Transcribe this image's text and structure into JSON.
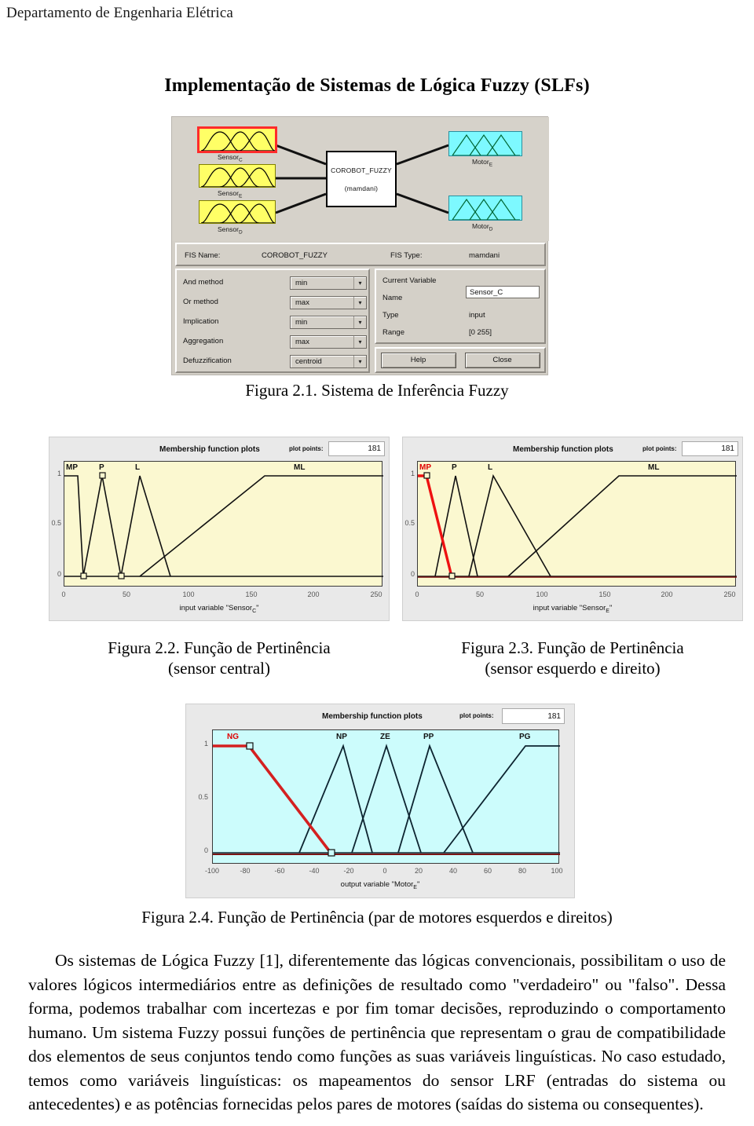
{
  "header": {
    "department": "Departamento de Engenharia Elétrica"
  },
  "page_title": "Implementação de Sistemas de Lógica Fuzzy (SLFs)",
  "fis_editor": {
    "center_name": "COROBOT_FUZZY",
    "center_type": "(mamdani)",
    "inputs": [
      {
        "label": "Sensor",
        "sub": "C",
        "selected": true
      },
      {
        "label": "Sensor",
        "sub": "E",
        "selected": false
      },
      {
        "label": "Sensor",
        "sub": "D",
        "selected": false
      }
    ],
    "outputs": [
      {
        "label": "Motor",
        "sub": "E"
      },
      {
        "label": "Motor",
        "sub": "D"
      }
    ],
    "fis_name_label": "FIS Name:",
    "fis_name_value": "COROBOT_FUZZY",
    "fis_type_label": "FIS Type:",
    "fis_type_value": "mamdani",
    "options": [
      {
        "label": "And method",
        "value": "min"
      },
      {
        "label": "Or method",
        "value": "max"
      },
      {
        "label": "Implication",
        "value": "min"
      },
      {
        "label": "Aggregation",
        "value": "max"
      },
      {
        "label": "Defuzzification",
        "value": "centroid"
      }
    ],
    "current_variable": {
      "title": "Current Variable",
      "name_label": "Name",
      "name_value": "Sensor_C",
      "type_label": "Type",
      "type_value": "input",
      "range_label": "Range",
      "range_value": "[0 255]"
    },
    "buttons": {
      "help": "Help",
      "close": "Close"
    }
  },
  "captions": {
    "fig21": "Figura 2.1. Sistema de Inferência Fuzzy",
    "fig22_line1": "Figura 2.2. Função de Pertinência",
    "fig22_line2": "(sensor central)",
    "fig23_line1": "Figura 2.3. Função de Pertinência",
    "fig23_line2": "(sensor esquerdo e direito)",
    "fig24": "Figura 2.4. Função de Pertinência (par de motores esquerdos e direitos)"
  },
  "chart_data": [
    {
      "id": "fig22",
      "type": "line",
      "title": "Membership function plots",
      "plot_points_label": "plot points:",
      "plot_points": "181",
      "xlabel": "input variable \"Sensor_C\"",
      "xlabel_main": "input variable \"Sensor",
      "xlabel_sub": "C",
      "xlabel_tail": "\"",
      "ylabel": "",
      "xlim": [
        0,
        255
      ],
      "ylim": [
        0,
        1
      ],
      "xticks": [
        "0",
        "50",
        "100",
        "150",
        "200",
        "250"
      ],
      "xtick_values": [
        0,
        50,
        100,
        150,
        200,
        250
      ],
      "yticks": [
        "0",
        "0.5",
        "1"
      ],
      "ytick_values": [
        0,
        0.5,
        1
      ],
      "grid": false,
      "series": [
        {
          "name": "MP",
          "label_x": 3,
          "highlight": false,
          "points": [
            [
              0,
              1
            ],
            [
              11,
              1
            ],
            [
              15,
              0
            ]
          ]
        },
        {
          "name": "P",
          "label_x": 27,
          "highlight": false,
          "points": [
            [
              15,
              0
            ],
            [
              30,
              1
            ],
            [
              45,
              0
            ]
          ]
        },
        {
          "name": "L",
          "label_x": 56,
          "highlight": false,
          "points": [
            [
              45,
              0
            ],
            [
              60,
              1
            ],
            [
              85,
              0
            ]
          ]
        },
        {
          "name": "ML",
          "label_x": 185,
          "highlight": false,
          "points": [
            [
              60,
              0
            ],
            [
              160,
              1
            ],
            [
              255,
              1
            ]
          ]
        }
      ]
    },
    {
      "id": "fig23",
      "type": "line",
      "title": "Membership function plots",
      "plot_points_label": "plot points:",
      "plot_points": "181",
      "xlabel": "input variable \"Sensor_E\"",
      "xlabel_main": "input variable \"Sensor",
      "xlabel_sub": "E",
      "xlabel_tail": "\"",
      "xlim": [
        0,
        255
      ],
      "ylim": [
        0,
        1
      ],
      "xticks": [
        "0",
        "50",
        "100",
        "150",
        "200",
        "250"
      ],
      "xtick_values": [
        0,
        50,
        100,
        150,
        200,
        250
      ],
      "yticks": [
        "0",
        "0.5",
        "1"
      ],
      "ytick_values": [
        0,
        0.5,
        1
      ],
      "grid": false,
      "series": [
        {
          "name": "MP",
          "label_x": 3,
          "highlight": true,
          "points": [
            [
              0,
              1
            ],
            [
              7,
              1
            ],
            [
              27,
              0
            ]
          ]
        },
        {
          "name": "P",
          "label_x": 25,
          "highlight": false,
          "points": [
            [
              14,
              0
            ],
            [
              30,
              1
            ],
            [
              48,
              0
            ]
          ]
        },
        {
          "name": "L",
          "label_x": 54,
          "highlight": false,
          "points": [
            [
              41,
              0
            ],
            [
              60,
              1
            ],
            [
              106,
              0
            ]
          ]
        },
        {
          "name": "ML",
          "label_x": 186,
          "highlight": false,
          "points": [
            [
              72,
              0
            ],
            [
              161,
              1
            ],
            [
              255,
              1
            ]
          ]
        }
      ]
    },
    {
      "id": "fig24",
      "type": "line",
      "title": "Membership function plots",
      "plot_points_label": "plot points:",
      "plot_points": "181",
      "xlabel": "output variable \"Motor_E\"",
      "xlabel_main": "output variable \"Motor",
      "xlabel_sub": "E",
      "xlabel_tail": "\"",
      "xlim": [
        -100,
        100
      ],
      "ylim": [
        0,
        1
      ],
      "xticks": [
        "-100",
        "-80",
        "-60",
        "-40",
        "-20",
        "0",
        "20",
        "40",
        "60",
        "80",
        "100"
      ],
      "xtick_values": [
        -100,
        -80,
        -60,
        -40,
        -20,
        0,
        20,
        40,
        60,
        80,
        100
      ],
      "yticks": [
        "0",
        "0.5",
        "1"
      ],
      "ytick_values": [
        0,
        0.5,
        1
      ],
      "grid": false,
      "series": [
        {
          "name": "NG",
          "label_x": -90,
          "highlight": true,
          "points": [
            [
              -100,
              1
            ],
            [
              -79,
              1
            ],
            [
              -32,
              0
            ]
          ]
        },
        {
          "name": "NP",
          "label_x": -28,
          "highlight": false,
          "points": [
            [
              -50,
              0
            ],
            [
              -25,
              1
            ],
            [
              -8,
              0
            ]
          ]
        },
        {
          "name": "ZE",
          "label_x": -3,
          "highlight": false,
          "points": [
            [
              -20,
              0
            ],
            [
              0,
              1
            ],
            [
              20,
              0
            ]
          ]
        },
        {
          "name": "PP",
          "label_x": 21,
          "highlight": false,
          "points": [
            [
              7,
              0
            ],
            [
              25,
              1
            ],
            [
              50,
              0
            ]
          ]
        },
        {
          "name": "PG",
          "label_x": 76,
          "highlight": false,
          "points": [
            [
              33,
              0
            ],
            [
              80,
              1
            ],
            [
              100,
              1
            ]
          ]
        }
      ]
    }
  ],
  "body_paragraph": "Os sistemas de Lógica Fuzzy [1], diferentemente das lógicas convencionais, possibilitam o uso de valores lógicos intermediários entre as definições de resultado como \"verdadeiro\" ou \"falso\". Dessa forma, podemos trabalhar com incertezas e por fim tomar decisões, reproduzindo o comportamento humano. Um sistema Fuzzy possui funções de pertinência que representam o grau de compatibilidade dos elementos de seus conjuntos tendo como funções as suas variáveis linguísticas. No caso estudado, temos como variáveis linguísticas: os mapeamentos do sensor LRF (entradas do sistema ou antecedentes) e as potências fornecidas pelos pares de motores (saídas do sistema ou consequentes)."
}
